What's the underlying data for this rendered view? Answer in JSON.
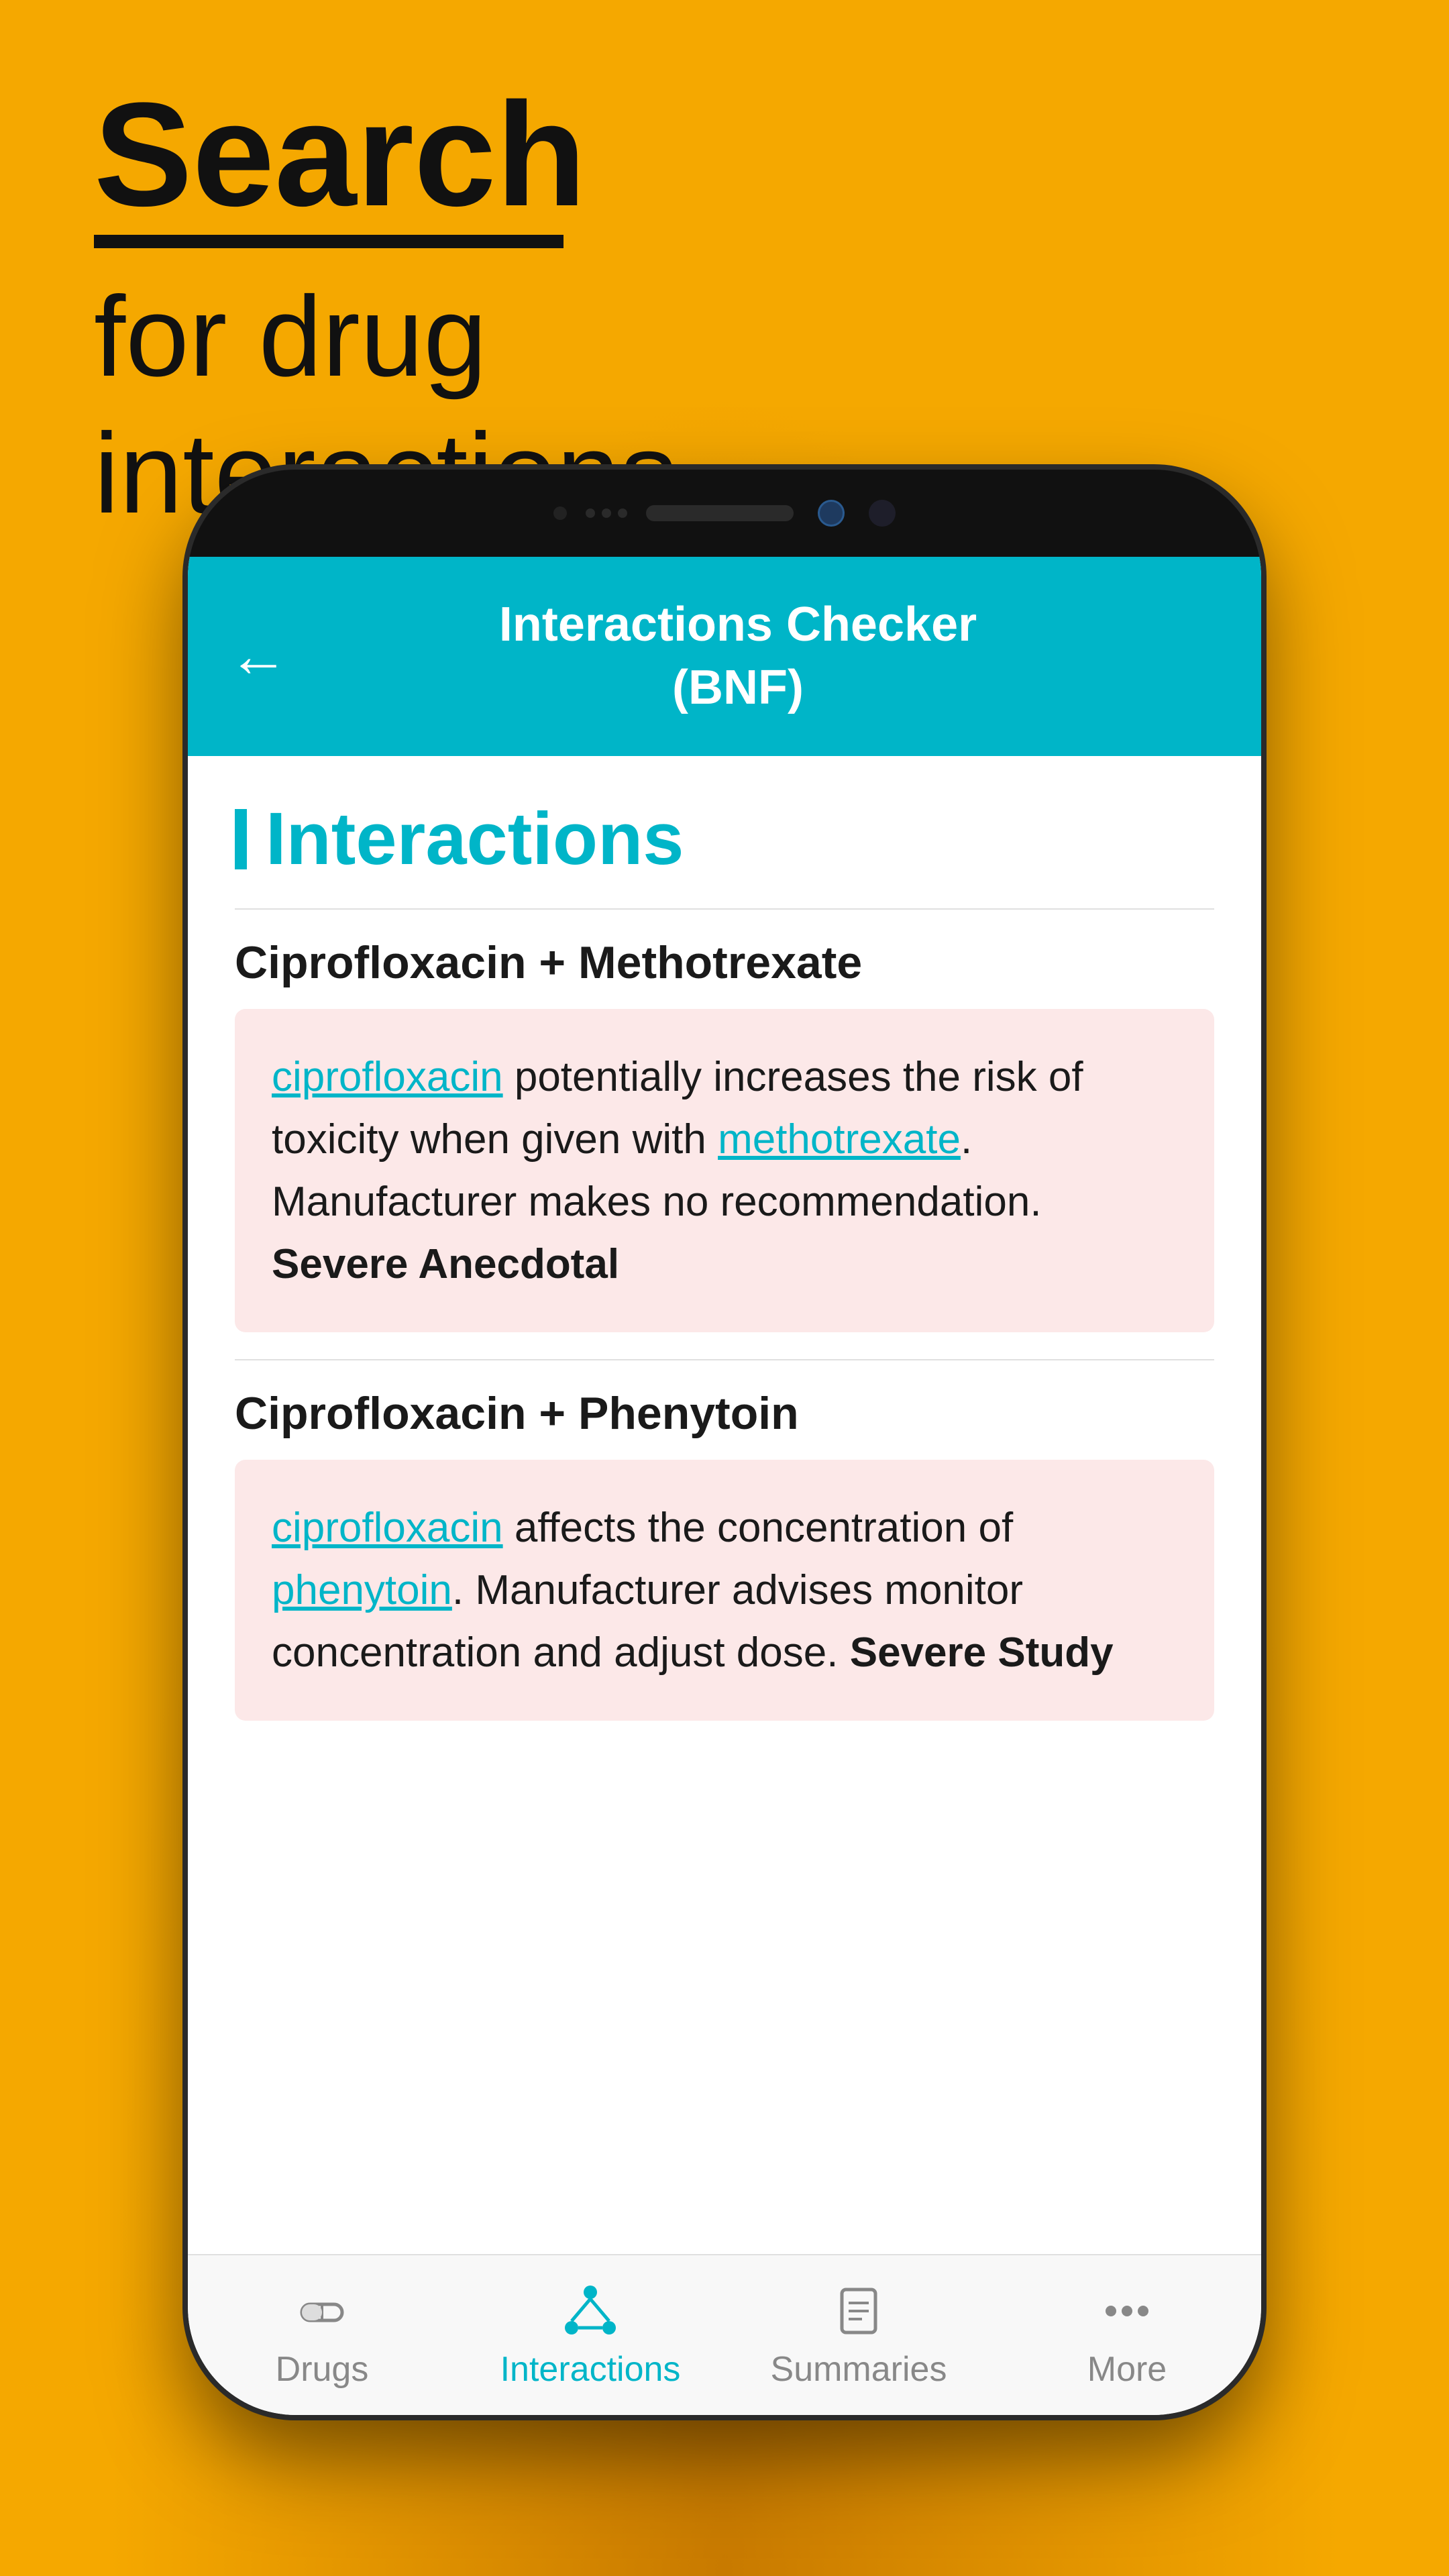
{
  "background": {
    "color": "#F5A800"
  },
  "header": {
    "search_label": "Search",
    "subtitle": "for drug\ninteractions"
  },
  "app": {
    "title_line1": "Interactions Checker",
    "title_line2": "(BNF)",
    "back_label": "←",
    "section_title": "Interactions"
  },
  "interactions": [
    {
      "pair": "Ciprofloxacin + Methotrexate",
      "drug1": "ciprofloxacin",
      "text_middle": " potentially increases the risk of toxicity when given with ",
      "drug2": "methotrexate",
      "text_end": ". Manufacturer makes no recommendation.",
      "severity": "Severe Anecdotal"
    },
    {
      "pair": "Ciprofloxacin + Phenytoin",
      "drug1": "ciprofloxacin",
      "text_middle": " affects the concentration of ",
      "drug2": "phenytoin",
      "text_end": ". Manufacturer advises monitor concentration and adjust dose.",
      "severity": "Severe Study"
    }
  ],
  "tabs": [
    {
      "id": "drugs",
      "label": "Drugs",
      "active": false
    },
    {
      "id": "interactions",
      "label": "Interactions",
      "active": true
    },
    {
      "id": "summaries",
      "label": "Summaries",
      "active": false
    },
    {
      "id": "more",
      "label": "More",
      "active": false
    }
  ]
}
